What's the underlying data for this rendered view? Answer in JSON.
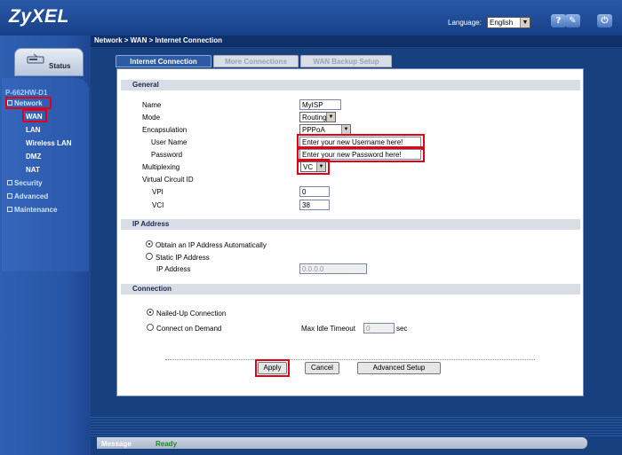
{
  "header": {
    "logo": "ZyXEL",
    "language_label": "Language:",
    "language_value": "English",
    "icons": [
      "help-icon",
      "wizard-icon",
      "logout-icon"
    ]
  },
  "breadcrumb": "Network > WAN > Internet Connection",
  "sidebar": {
    "status_tab": "Status",
    "device": "P-662HW-D1",
    "items": [
      {
        "label": "Network",
        "icon": "minus-icon"
      },
      {
        "label": "WAN"
      },
      {
        "label": "LAN"
      },
      {
        "label": "Wireless LAN"
      },
      {
        "label": "DMZ"
      },
      {
        "label": "NAT"
      },
      {
        "label": "Security",
        "icon": "plus-icon"
      },
      {
        "label": "Advanced",
        "icon": "plus-icon"
      },
      {
        "label": "Maintenance",
        "icon": "plus-icon"
      }
    ]
  },
  "tabs": [
    {
      "label": "Internet Connection",
      "active": true
    },
    {
      "label": "More Connections",
      "active": false
    },
    {
      "label": "WAN Backup Setup",
      "active": false
    }
  ],
  "general": {
    "heading": "General",
    "name_label": "Name",
    "name_value": "MyISP",
    "mode_label": "Mode",
    "mode_value": "Routing",
    "encapsulation_label": "Encapsulation",
    "encapsulation_value": "PPPoA",
    "username_label": "User Name",
    "username_value": "Enter your new Username here!",
    "password_label": "Password",
    "password_value": "Enter your new Password here!",
    "multiplexing_label": "Multiplexing",
    "multiplexing_value": "VC",
    "vcid_label": "Virtual Circuit ID",
    "vpi_label": "VPI",
    "vpi_value": "0",
    "vci_label": "VCI",
    "vci_value": "38"
  },
  "ip_address": {
    "heading": "IP Address",
    "option_auto": "Obtain an IP Address Automatically",
    "option_static": "Static IP Address",
    "ip_label": "IP Address",
    "ip_value": "0.0.0.0"
  },
  "connection": {
    "heading": "Connection",
    "option_nailed": "Nailed-Up Connection",
    "option_demand": "Connect on Demand",
    "idle_label": "Max Idle Timeout",
    "idle_value": "0",
    "idle_unit": "sec"
  },
  "buttons": {
    "apply": "Apply",
    "cancel": "Cancel",
    "advanced": "Advanced Setup"
  },
  "status_bar": {
    "label": "Message",
    "value": "Ready"
  },
  "colors": {
    "highlight": "#e00018",
    "nav_bg": "#2856a6",
    "status_ready": "#1b8a1b"
  }
}
